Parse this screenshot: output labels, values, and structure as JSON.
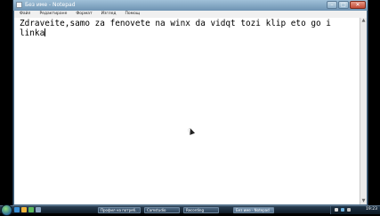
{
  "window": {
    "title": "Без име - Notepad",
    "minimize": "–",
    "maximize": "□",
    "close": "✕"
  },
  "menu": [
    "Файл",
    "Редактиране",
    "Формат",
    "Изглед",
    "Помощ"
  ],
  "document": {
    "text": "Zdraveite,samo za fenovete na winx da vidqt tozi klip eto go i linka"
  },
  "taskbar": {
    "tasks": [
      "Профил на потреб...",
      "Camstudio",
      "Recording",
      "Без име - Notepad"
    ],
    "clock": "19:23"
  },
  "colors": {
    "accent": "#6e93b2",
    "taskbar": "#0e1a26"
  }
}
